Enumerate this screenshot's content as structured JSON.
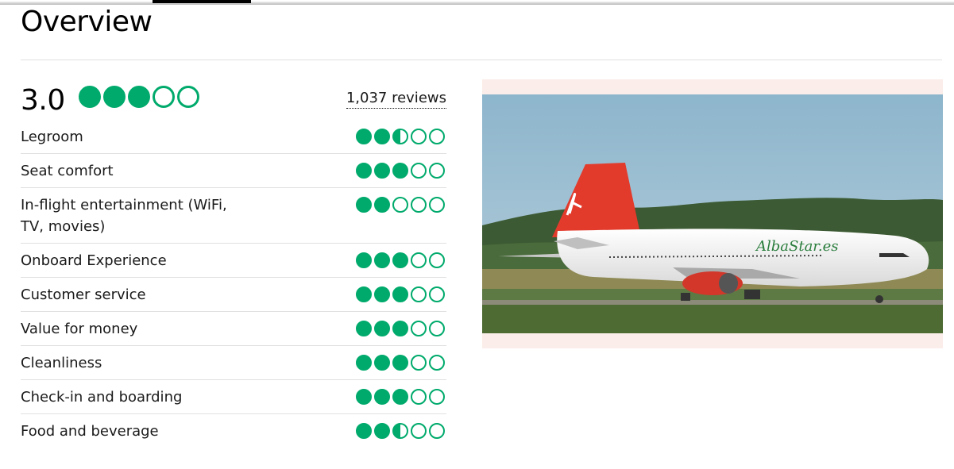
{
  "header": {
    "title": "Overview"
  },
  "overall": {
    "score": "3.0",
    "bubbles": 3,
    "reviews_label": "1,037 reviews"
  },
  "colors": {
    "bubble": "#00aa6c",
    "photo_background": "#fbeeea"
  },
  "ratings": [
    {
      "label": "Legroom",
      "value": 2.5
    },
    {
      "label": "Seat comfort",
      "value": 3
    },
    {
      "label": "In-flight entertainment (WiFi, TV, movies)",
      "value": 2
    },
    {
      "label": "Onboard Experience",
      "value": 3
    },
    {
      "label": "Customer service",
      "value": 3
    },
    {
      "label": "Value for money",
      "value": 3
    },
    {
      "label": "Cleanliness",
      "value": 3
    },
    {
      "label": "Check-in and boarding",
      "value": 3
    },
    {
      "label": "Food and beverage",
      "value": 2.5
    }
  ],
  "photo": {
    "airline_livery_text": "AlbaStar.es",
    "tail_letter": "A"
  }
}
